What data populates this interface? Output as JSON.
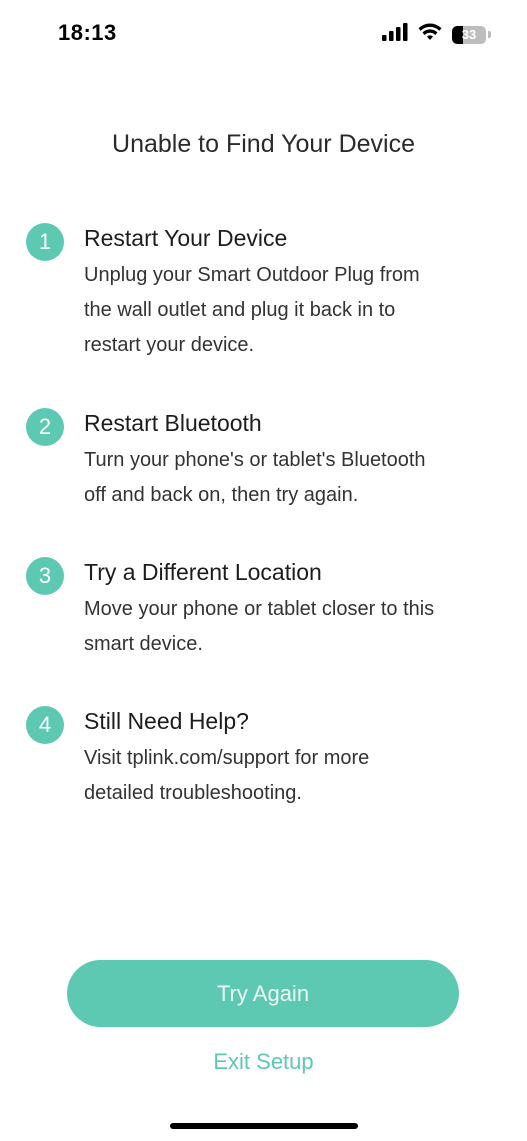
{
  "status_bar": {
    "time": "18:13",
    "battery_level": "33",
    "battery_fraction": 0.33,
    "icons": [
      "cellular-signal-icon",
      "wifi-icon",
      "battery-icon"
    ]
  },
  "title": "Unable to Find Your Device",
  "steps": [
    {
      "number": "1",
      "title": "Restart Your Device",
      "lines": [
        "Unplug your Smart Outdoor Plug from",
        "the wall outlet and plug it back in to",
        "restart your device."
      ]
    },
    {
      "number": "2",
      "title": "Restart Bluetooth",
      "lines": [
        "Turn your phone's or tablet's Bluetooth",
        "off and back on, then try again."
      ]
    },
    {
      "number": "3",
      "title": "Try a Different Location",
      "lines": [
        "Move your phone or tablet closer to this",
        "smart device."
      ]
    },
    {
      "number": "4",
      "title": "Still Need Help?",
      "lines": [
        "Visit tplink.com/support for more",
        "detailed troubleshooting."
      ]
    }
  ],
  "actions": {
    "primary_label": "Try Again",
    "secondary_label": "Exit Setup"
  },
  "colors": {
    "accent": "#5ec9b3",
    "text": "#1d1d1f",
    "background": "#ffffff"
  }
}
